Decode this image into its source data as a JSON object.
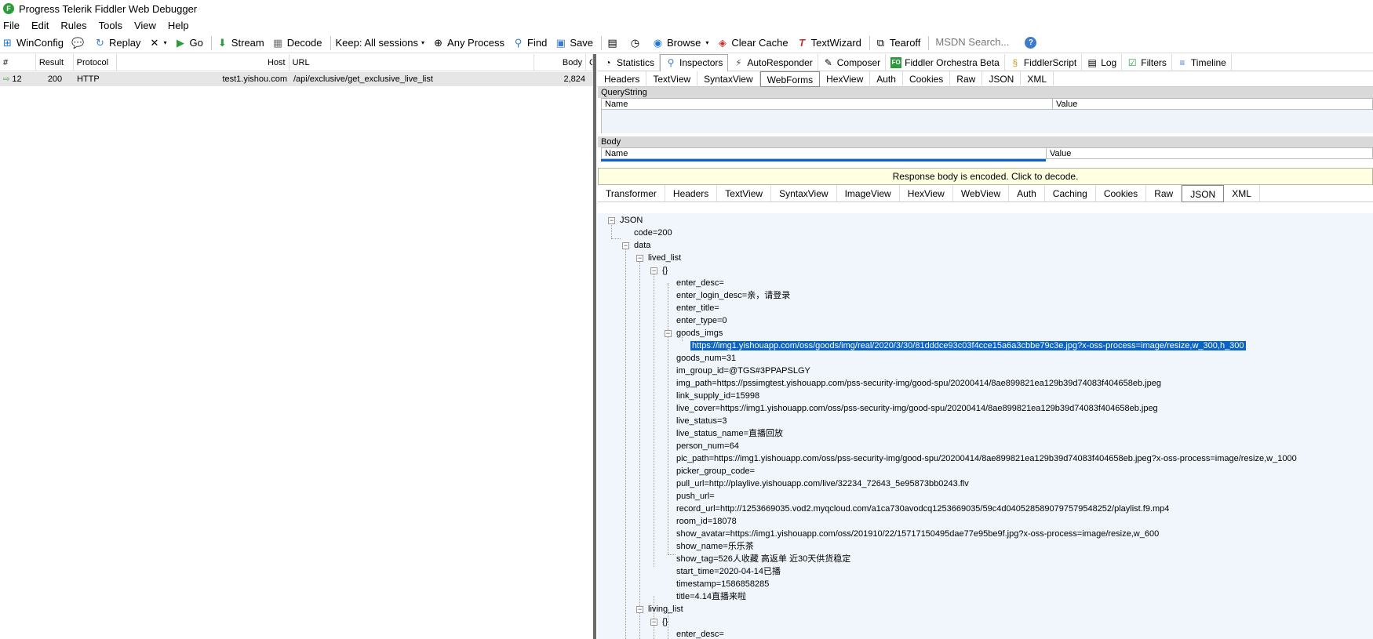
{
  "window": {
    "title": "Progress Telerik Fiddler Web Debugger",
    "icon": "fiddler-logo-icon"
  },
  "menu": [
    "File",
    "Edit",
    "Rules",
    "Tools",
    "View",
    "Help"
  ],
  "toolbar": {
    "winconfig": "WinConfig",
    "replay": "Replay",
    "go": "Go",
    "stream": "Stream",
    "decode": "Decode",
    "keep": "Keep: All sessions",
    "any_process": "Any Process",
    "find": "Find",
    "save": "Save",
    "browse": "Browse",
    "clear_cache": "Clear Cache",
    "textwizard": "TextWizard",
    "tearoff": "Tearoff",
    "msdn_placeholder": "MSDN Search..."
  },
  "sessions": {
    "columns": [
      "#",
      "Result",
      "Protocol",
      "Host",
      "URL",
      "Body",
      "Ca"
    ],
    "rows": [
      {
        "num": "12",
        "result": "200",
        "protocol": "HTTP",
        "host": "test1.yishou.com",
        "url": "/api/exclusive/get_exclusive_live_list",
        "body": "2,824"
      }
    ]
  },
  "top_tabs": [
    "Statistics",
    "Inspectors",
    "AutoResponder",
    "Composer",
    "Fiddler Orchestra Beta",
    "FiddlerScript",
    "Log",
    "Filters",
    "Timeline"
  ],
  "request_tabs": [
    "Headers",
    "TextView",
    "SyntaxView",
    "WebForms",
    "HexView",
    "Auth",
    "Cookies",
    "Raw",
    "JSON",
    "XML"
  ],
  "querystring": {
    "title": "QueryString",
    "name_col": "Name",
    "value_col": "Value"
  },
  "body": {
    "title": "Body",
    "name_col": "Name",
    "value_col": "Value"
  },
  "notice": "Response body is encoded. Click to decode.",
  "response_tabs": [
    "Transformer",
    "Headers",
    "TextView",
    "SyntaxView",
    "ImageView",
    "HexView",
    "WebView",
    "Auth",
    "Caching",
    "Cookies",
    "Raw",
    "JSON",
    "XML"
  ],
  "tree": {
    "root": "JSON",
    "code": "code=200",
    "data": "data",
    "lived_list": "lived_list",
    "obj": "{}",
    "fields_a": [
      "enter_desc=",
      "enter_login_desc=亲，请登录",
      "enter_title=",
      "enter_type=0"
    ],
    "goods_imgs": "goods_imgs",
    "goods_img_url": "https://img1.yishouapp.com/oss/goods/img/real/2020/3/30/81dddce93c03f4cce15a6a3cbbe79c3e.jpg?x-oss-process=image/resize,w_300,h_300",
    "fields_b": [
      "goods_num=31",
      "im_group_id=@TGS#3PPAPSLGY",
      "img_path=https://pssimgtest.yishouapp.com/pss-security-img/good-spu/20200414/8ae899821ea129b39d74083f404658eb.jpeg",
      "link_supply_id=15998",
      "live_cover=https://img1.yishouapp.com/oss/pss-security-img/good-spu/20200414/8ae899821ea129b39d74083f404658eb.jpeg",
      "live_status=3",
      "live_status_name=直播回放",
      "person_num=64",
      "pic_path=https://img1.yishouapp.com/oss/pss-security-img/good-spu/20200414/8ae899821ea129b39d74083f404658eb.jpeg?x-oss-process=image/resize,w_1000",
      "picker_group_code=",
      "pull_url=http://playlive.yishouapp.com/live/32234_72643_5e95873bb0243.flv",
      "push_url=",
      "record_url=http://1253669035.vod2.myqcloud.com/a1ca730avodcq1253669035/59c4d0405285890797579548252/playlist.f9.mp4",
      "room_id=18078",
      "show_avatar=https://img1.yishouapp.com/oss/201910/22/15717150495dae77e95be9f.jpg?x-oss-process=image/resize,w_600",
      "show_name=乐乐茶",
      "show_tag=526人收藏 高返单 近30天供货稳定",
      "start_time=2020-04-14已播",
      "timestamp=1586858285",
      "title=4.14直播来啦"
    ],
    "living_list": "living_list",
    "obj2": "{}",
    "enter_desc2": "enter_desc="
  }
}
